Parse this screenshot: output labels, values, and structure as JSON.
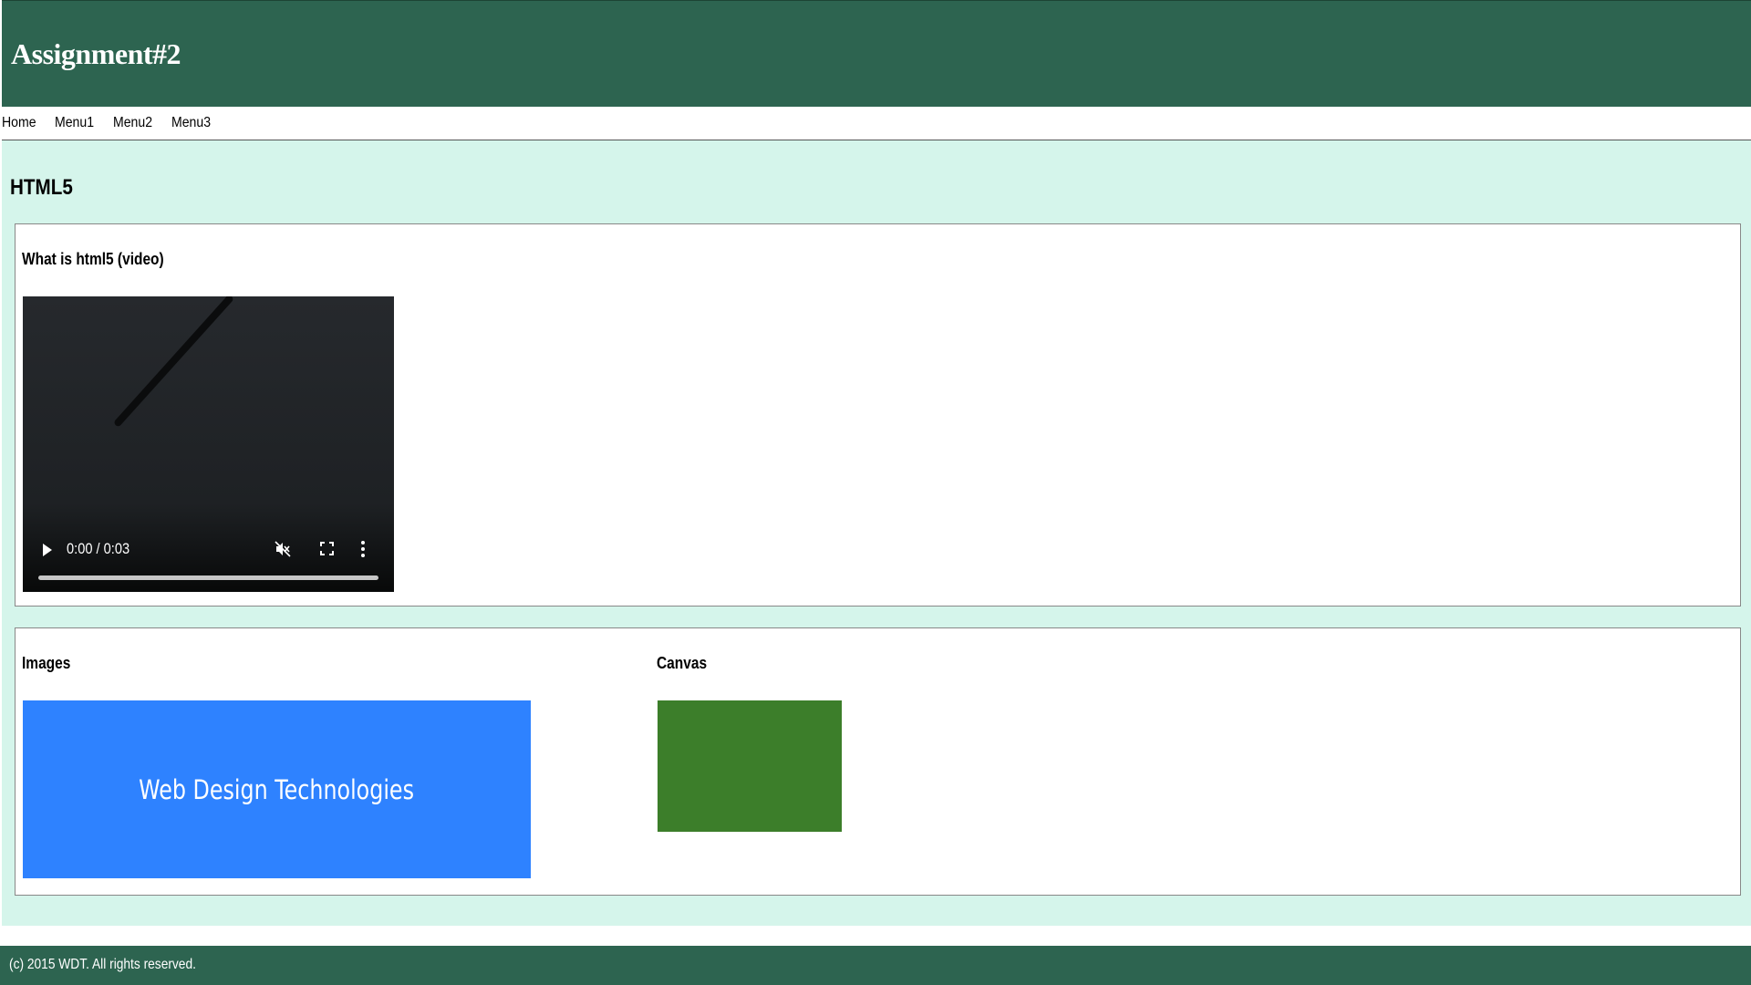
{
  "header": {
    "title": "Assignment#2"
  },
  "nav": {
    "items": [
      "Home",
      "Menu1",
      "Menu2",
      "Menu3"
    ]
  },
  "main": {
    "title": "HTML5",
    "video_section": {
      "heading": "What is html5 (video)",
      "player": {
        "time": "0:00 / 0:03",
        "progress": 0,
        "muted": true
      }
    },
    "images_section": {
      "heading": "Images",
      "banner_text": "Web Design Technologies"
    },
    "canvas_section": {
      "heading": "Canvas"
    }
  },
  "footer": {
    "text": "(c) 2015 WDT. All rights reserved."
  },
  "colors": {
    "header_bg": "#2d6450",
    "main_bg": "#d5f5eb",
    "banner_bg": "#2e82ff",
    "canvas_fill": "#3c7e2a"
  }
}
